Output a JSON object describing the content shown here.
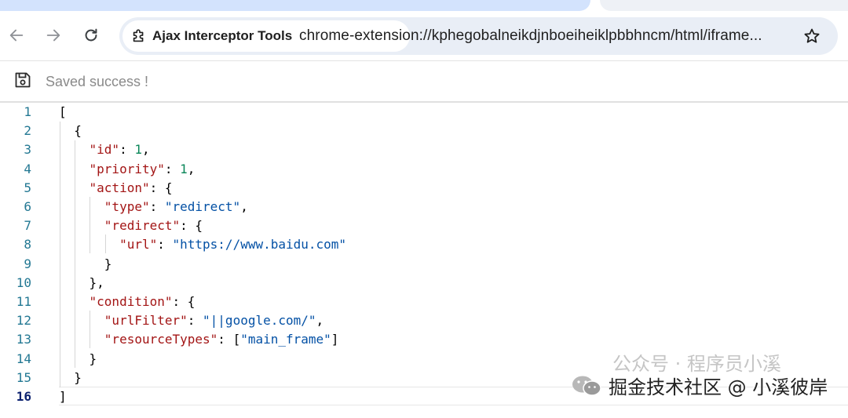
{
  "browser": {
    "tab_title": "Ajax Interceptor Tools",
    "url": "chrome-extension://kphegobalneikdjnboeiheiklpbbhncm/html/iframe..."
  },
  "savebar": {
    "status_text": "Saved success !"
  },
  "editor": {
    "active_line": 16,
    "lines": [
      {
        "n": "1",
        "tokens": [
          [
            "p",
            "["
          ]
        ]
      },
      {
        "n": "2",
        "tokens": [
          [
            "p",
            "  {"
          ]
        ]
      },
      {
        "n": "3",
        "tokens": [
          [
            "p",
            "    "
          ],
          [
            "k",
            "\"id\""
          ],
          [
            "p",
            ": "
          ],
          [
            "n",
            "1"
          ],
          [
            "p",
            ","
          ]
        ]
      },
      {
        "n": "4",
        "tokens": [
          [
            "p",
            "    "
          ],
          [
            "k",
            "\"priority\""
          ],
          [
            "p",
            ": "
          ],
          [
            "n",
            "1"
          ],
          [
            "p",
            ","
          ]
        ]
      },
      {
        "n": "5",
        "tokens": [
          [
            "p",
            "    "
          ],
          [
            "k",
            "\"action\""
          ],
          [
            "p",
            ": {"
          ]
        ]
      },
      {
        "n": "6",
        "tokens": [
          [
            "p",
            "      "
          ],
          [
            "k",
            "\"type\""
          ],
          [
            "p",
            ": "
          ],
          [
            "s",
            "\"redirect\""
          ],
          [
            "p",
            ","
          ]
        ]
      },
      {
        "n": "7",
        "tokens": [
          [
            "p",
            "      "
          ],
          [
            "k",
            "\"redirect\""
          ],
          [
            "p",
            ": {"
          ]
        ]
      },
      {
        "n": "8",
        "tokens": [
          [
            "p",
            "        "
          ],
          [
            "k",
            "\"url\""
          ],
          [
            "p",
            ": "
          ],
          [
            "s",
            "\"https://www.baidu.com\""
          ]
        ]
      },
      {
        "n": "9",
        "tokens": [
          [
            "p",
            "      }"
          ]
        ]
      },
      {
        "n": "10",
        "tokens": [
          [
            "p",
            "    },"
          ]
        ]
      },
      {
        "n": "11",
        "tokens": [
          [
            "p",
            "    "
          ],
          [
            "k",
            "\"condition\""
          ],
          [
            "p",
            ": {"
          ]
        ]
      },
      {
        "n": "12",
        "tokens": [
          [
            "p",
            "      "
          ],
          [
            "k",
            "\"urlFilter\""
          ],
          [
            "p",
            ": "
          ],
          [
            "s",
            "\"||google.com/\""
          ],
          [
            "p",
            ","
          ]
        ]
      },
      {
        "n": "13",
        "tokens": [
          [
            "p",
            "      "
          ],
          [
            "k",
            "\"resourceTypes\""
          ],
          [
            "p",
            ": ["
          ],
          [
            "s",
            "\"main_frame\""
          ],
          [
            "p",
            "]"
          ]
        ]
      },
      {
        "n": "14",
        "tokens": [
          [
            "p",
            "    }"
          ]
        ]
      },
      {
        "n": "15",
        "tokens": [
          [
            "p",
            "  }"
          ]
        ]
      },
      {
        "n": "16",
        "tokens": [
          [
            "p",
            "]"
          ]
        ]
      }
    ]
  },
  "watermark": {
    "line1": "公众号 · 程序员小溪",
    "line2": "掘金技术社区 @ 小溪彼岸"
  },
  "colors": {
    "key": "#a31515",
    "string": "#0451a5",
    "number": "#098658",
    "line_number": "#237893",
    "omnibox": "#e9eef6",
    "active_tab": "#d3e3fd"
  }
}
